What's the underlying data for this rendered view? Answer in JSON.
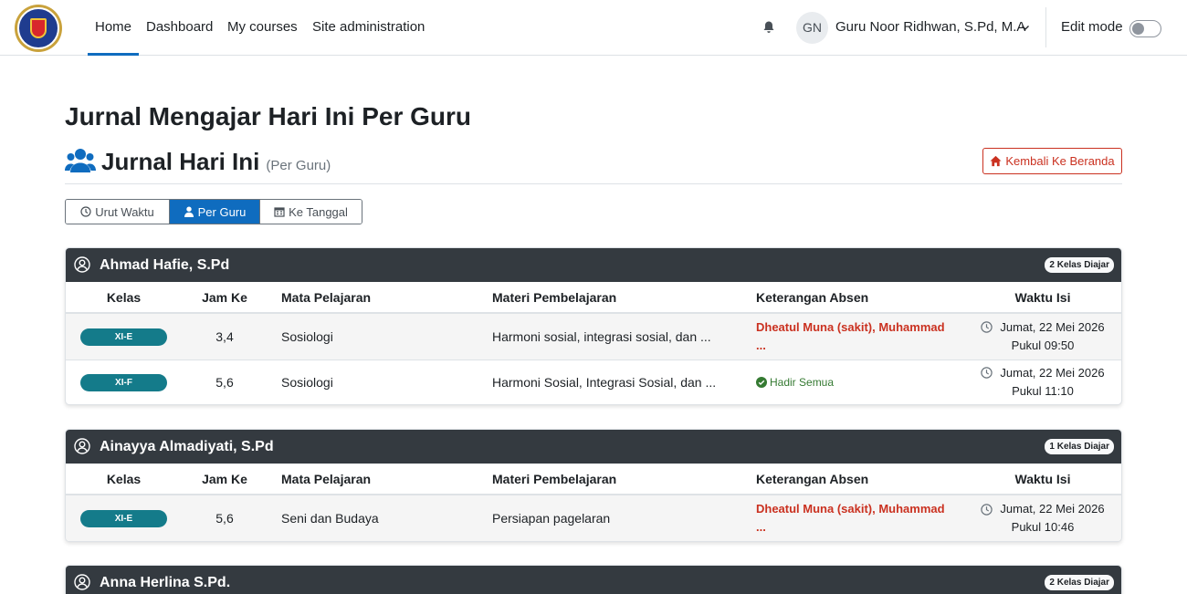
{
  "nav": {
    "items": [
      "Home",
      "Dashboard",
      "My courses",
      "Site administration"
    ],
    "avatar_initials": "GN",
    "user_name": "Guru Noor Ridhwan, S.Pd, M.A",
    "edit_mode_label": "Edit mode",
    "edit_mode_on": false
  },
  "page": {
    "title": "Jurnal Mengajar Hari Ini Per Guru",
    "section_title": "Jurnal Hari Ini",
    "section_subtitle": "(Per Guru)",
    "back_button": "Kembali Ke Beranda",
    "view_buttons": [
      "Urut Waktu",
      "Per Guru",
      "Ke Tanggal"
    ],
    "active_view": "Per Guru"
  },
  "table_headers": [
    "Kelas",
    "Jam Ke",
    "Mata Pelajaran",
    "Materi Pembelajaran",
    "Keterangan Absen",
    "Waktu Isi"
  ],
  "teachers": [
    {
      "name": "Ahmad Hafie, S.Pd",
      "badge": "2 Kelas Diajar",
      "rows": [
        {
          "kelas": "XI-E",
          "jam": "3,4",
          "mapel": "Sosiologi",
          "materi": "Harmoni sosial, integrasi sosial, dan ...",
          "absen_line1": "Dheatul Muna (sakit), Muhammad",
          "absen_line2": "...",
          "hadir": "",
          "waktu_tanggal": "Jumat, 22 Mei 2026",
          "waktu_pukul": "Pukul 09:50"
        },
        {
          "kelas": "XI-F",
          "jam": "5,6",
          "mapel": "Sosiologi",
          "materi": "Harmoni Sosial, Integrasi Sosial, dan ...",
          "absen_line1": "",
          "absen_line2": "",
          "hadir": "Hadir Semua",
          "waktu_tanggal": "Jumat, 22 Mei 2026",
          "waktu_pukul": "Pukul 11:10"
        }
      ]
    },
    {
      "name": "Ainayya Almadiyati, S.Pd",
      "badge": "1 Kelas Diajar",
      "rows": [
        {
          "kelas": "XI-E",
          "jam": "5,6",
          "mapel": "Seni dan Budaya",
          "materi": "Persiapan pagelaran",
          "absen_line1": "Dheatul Muna (sakit), Muhammad",
          "absen_line2": "...",
          "hadir": "",
          "waktu_tanggal": "Jumat, 22 Mei 2026",
          "waktu_pukul": "Pukul 10:46"
        }
      ]
    },
    {
      "name": "Anna Herlina S.Pd.",
      "badge": "2 Kelas Diajar",
      "rows": []
    }
  ],
  "colors": {
    "primary": "#0f6cbf",
    "danger": "#ca3120",
    "success": "#357a32",
    "card_header": "#343a40",
    "kelas_pill": "#147b8a"
  }
}
